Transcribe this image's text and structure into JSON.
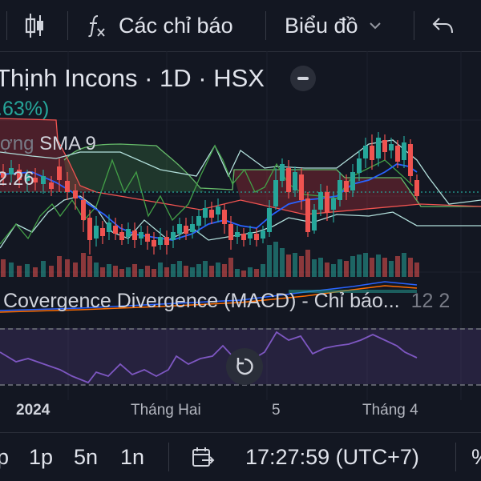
{
  "toolbar": {
    "indicators_label": "Các chỉ báo",
    "chart_type_label": "Biểu đồ",
    "icons": [
      "chart-style-icon",
      "function-icon",
      "chevron-down-icon",
      "undo-icon"
    ]
  },
  "legend": {
    "title": "Thịnh Incons · 1D · HSX",
    "change": ".63%)",
    "volume_label": "rợng",
    "volume_indicator": "SMA 9",
    "price": "2.26"
  },
  "macd": {
    "title": "Covergence Divergence (MACD) - Chỉ báo...",
    "params": "12 2"
  },
  "time_axis": {
    "labels": [
      "2024",
      "Tháng Hai",
      "5",
      "Tháng 4"
    ]
  },
  "bottom_bar": {
    "ranges": [
      "p",
      "1p",
      "5n",
      "1n"
    ],
    "clock": "17:27:59 (UTC+7)",
    "percent_label": "%"
  },
  "colors": {
    "background": "#131722",
    "up": "#26a69a",
    "down": "#ef5350",
    "ma_blue": "#2962ff",
    "cloud_green": "#4caf50",
    "cloud_red": "#f23645",
    "rsi": "#7e57c2"
  }
}
